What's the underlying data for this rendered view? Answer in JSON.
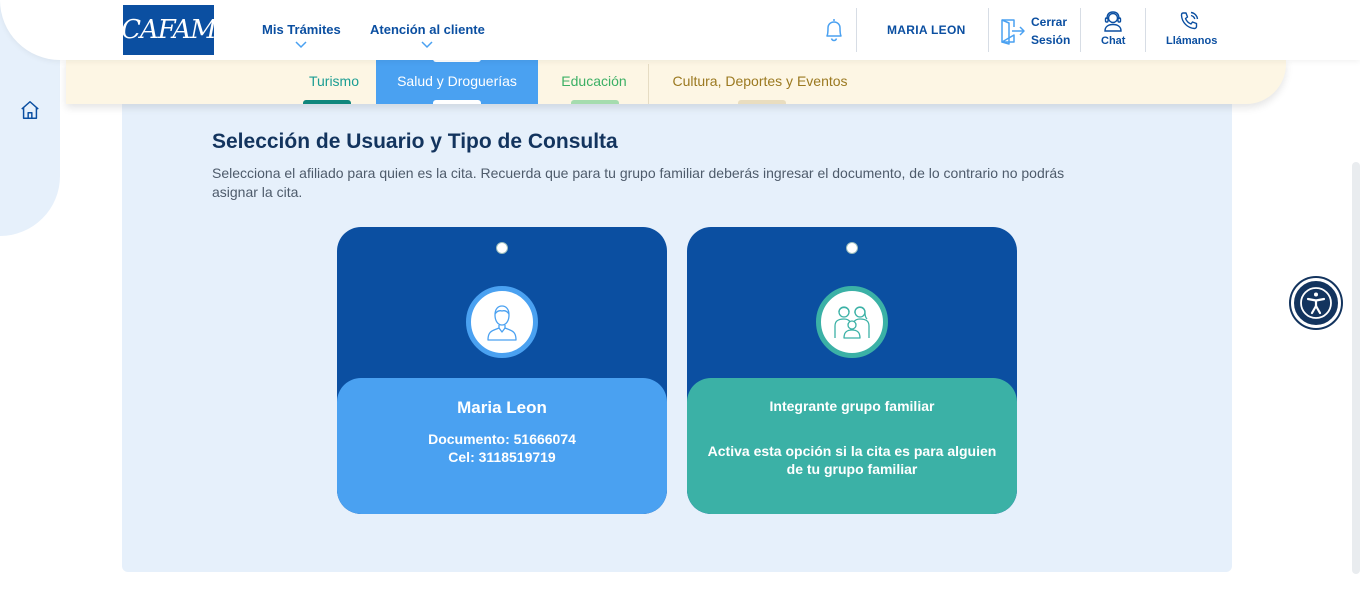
{
  "header": {
    "logo_text": "CAFAM",
    "nav": [
      {
        "label": "Mis Trámites"
      },
      {
        "label": "Atención al cliente"
      }
    ],
    "user_name": "MARIA LEON",
    "logout_line1": "Cerrar",
    "logout_line2": "Sesión",
    "chat_label": "Chat",
    "call_label": "Llámanos"
  },
  "tabs": [
    {
      "label": "Turismo",
      "color": "#1b9d93"
    },
    {
      "label": "Salud y Droguerías",
      "color": "#ffffff",
      "active": true
    },
    {
      "label": "Educación",
      "color": "#3db065"
    },
    {
      "label": "Cultura, Deportes y Eventos",
      "color": "#9b7920"
    }
  ],
  "main": {
    "title": "Selección de Usuario y Tipo de Consulta",
    "description": "Selecciona el afiliado para quien es la cita. Recuerda que para tu grupo familiar deberás ingresar el documento, de lo contrario no podrás asignar la cita.",
    "cards": [
      {
        "name": "Maria Leon",
        "document": "Documento: 51666074",
        "phone": "Cel: 3118519719",
        "icon": "person-icon"
      },
      {
        "title": "Integrante grupo familiar",
        "description": "Activa esta opción si la cita es para alguien de tu grupo familiar",
        "icon": "family-icon"
      }
    ]
  },
  "colors": {
    "primary": "#0b4fa1",
    "accent_blue": "#4aa1f1",
    "accent_teal": "#3bb1a6",
    "title": "#13345e",
    "panel_bg": "#e6f0fb"
  }
}
